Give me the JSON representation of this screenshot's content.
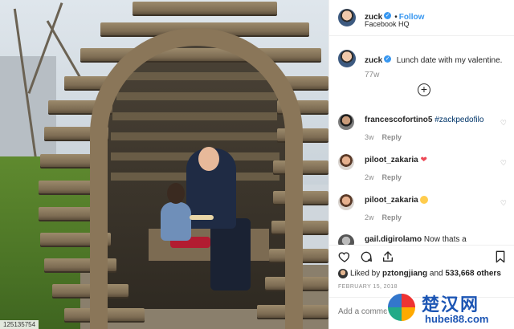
{
  "photo": {
    "corner_tag": "125135754"
  },
  "header": {
    "username": "zuck",
    "follow_label": "Follow",
    "separator": "•",
    "location": "Facebook HQ"
  },
  "caption": {
    "username": "zuck",
    "text": "Lunch date with my valentine.",
    "time": "77w"
  },
  "comments": [
    {
      "username": "francescofortino5",
      "text": "#zackpedofilo",
      "time": "3w",
      "reply_label": "Reply",
      "emoji": ""
    },
    {
      "username": "piloot_zakaria",
      "text": "",
      "time": "2w",
      "reply_label": "Reply",
      "emoji": "red-heart"
    },
    {
      "username": "piloot_zakaria",
      "text": "",
      "time": "2w",
      "reply_label": "Reply",
      "emoji": "smiling-face-heart-eyes"
    },
    {
      "username": "gail.digirolamo",
      "text": "Now thats a"
    }
  ],
  "likes": {
    "prefix": "Liked by",
    "user": "pztongjiang",
    "connector": "and",
    "others": "533,668 others"
  },
  "date": "FEBRUARY 15, 2018",
  "add_comment": {
    "placeholder": "Add a comment..."
  },
  "watermark": {
    "title": "楚汉网",
    "url": "hubei88.com"
  },
  "colors": {
    "link_blue": "#3897f0",
    "hashtag": "#003569",
    "heart_red": "#ed4956",
    "muted": "#8e8e8e"
  }
}
